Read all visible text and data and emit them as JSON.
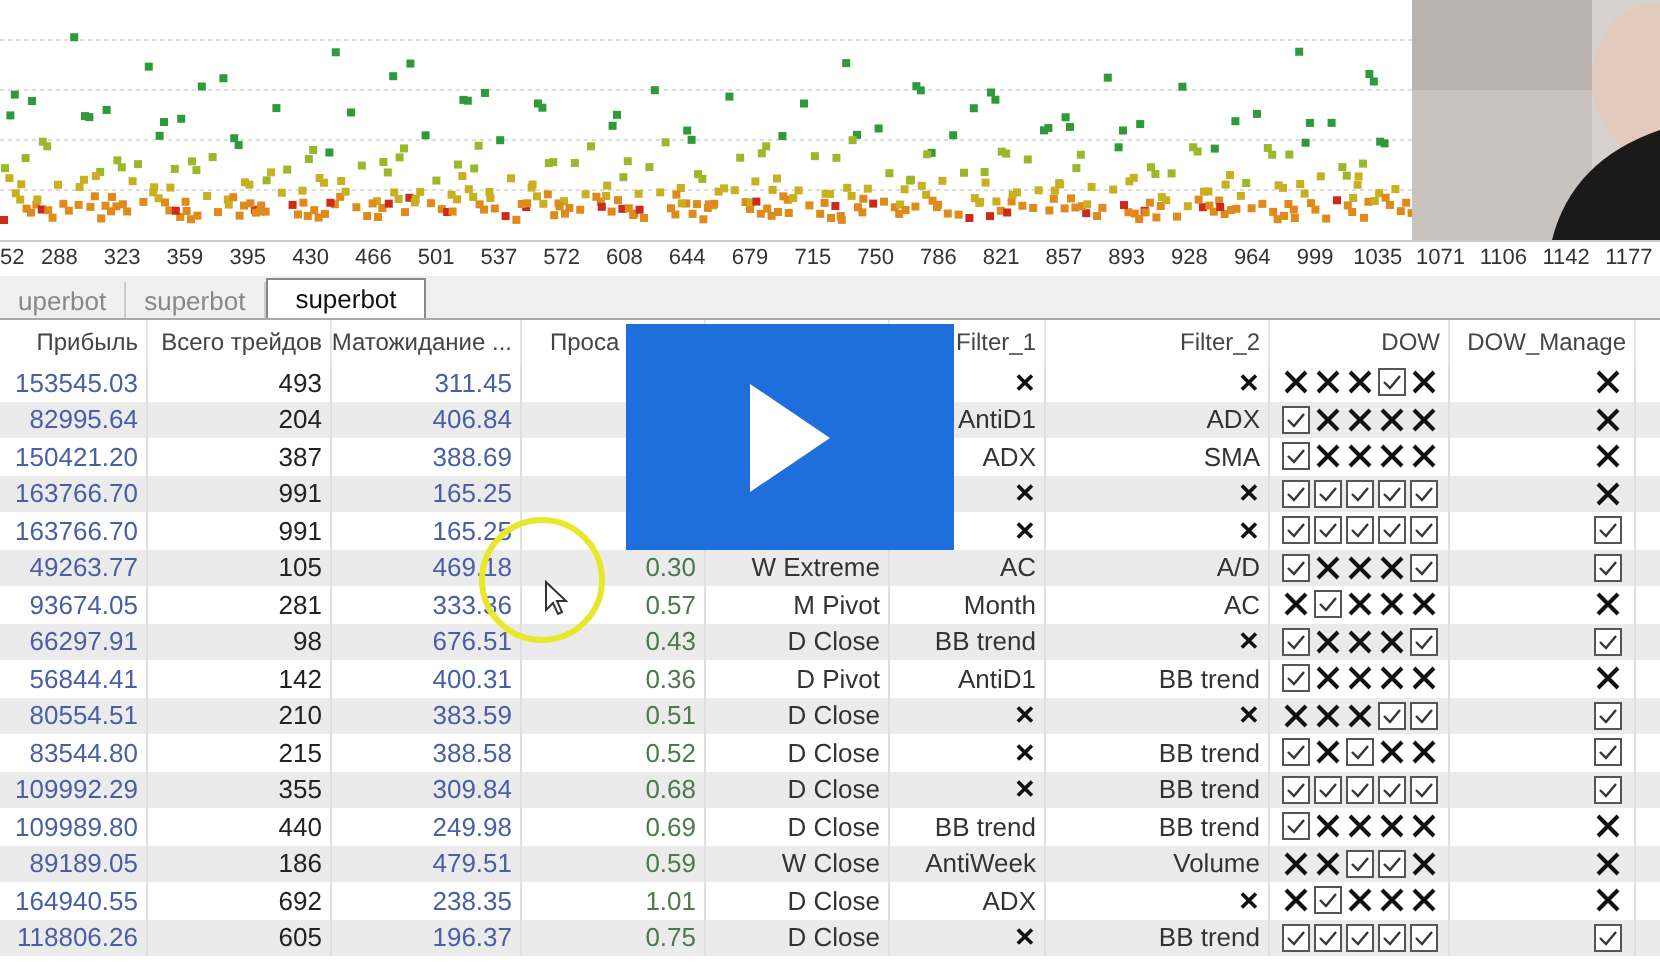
{
  "chart": {
    "x_tick_labels": [
      "52",
      "288",
      "323",
      "359",
      "395",
      "430",
      "466",
      "501",
      "537",
      "572",
      "608",
      "644",
      "679",
      "715",
      "750",
      "786",
      "821",
      "857",
      "893",
      "928",
      "964",
      "999",
      "1035",
      "1071",
      "1106",
      "1142",
      "1177"
    ]
  },
  "tabs": [
    {
      "label": "uperbot",
      "selected": false
    },
    {
      "label": "superbot",
      "selected": false
    },
    {
      "label": "superbot",
      "selected": true
    }
  ],
  "table": {
    "columns": [
      "Прибыль",
      "Всего трейдов",
      "Матожидание ...",
      "Проса",
      null,
      "Filter_1",
      "Filter_2",
      "DOW",
      "DOW_Manage"
    ],
    "rows": [
      {
        "profit": "153545.03",
        "trades": "493",
        "expectation": "311.45",
        "drawdown": null,
        "signal": null,
        "filter_1": "✕",
        "filter_2": "✕",
        "dow": [
          false,
          false,
          false,
          true,
          false
        ],
        "dow_manage": false
      },
      {
        "profit": "82995.64",
        "trades": "204",
        "expectation": "406.84",
        "drawdown": null,
        "signal": null,
        "filter_1": "AntiD1",
        "filter_2": "ADX",
        "dow": [
          true,
          false,
          false,
          false,
          false
        ],
        "dow_manage": false
      },
      {
        "profit": "150421.20",
        "trades": "387",
        "expectation": "388.69",
        "drawdown": null,
        "signal": null,
        "filter_1": "ADX",
        "filter_2": "SMA",
        "dow": [
          true,
          false,
          false,
          false,
          false
        ],
        "dow_manage": false
      },
      {
        "profit": "163766.70",
        "trades": "991",
        "expectation": "165.25",
        "drawdown": null,
        "signal": null,
        "filter_1": "✕",
        "filter_2": "✕",
        "dow": [
          true,
          true,
          true,
          true,
          true
        ],
        "dow_manage": false
      },
      {
        "profit": "163766.70",
        "trades": "991",
        "expectation": "165.25",
        "drawdown": null,
        "signal": null,
        "filter_1": "✕",
        "filter_2": "✕",
        "dow": [
          true,
          true,
          true,
          true,
          true
        ],
        "dow_manage": true
      },
      {
        "profit": "49263.77",
        "trades": "105",
        "expectation": "469.18",
        "drawdown": "0.30",
        "signal": "W Extreme",
        "filter_1": "AC",
        "filter_2": "A/D",
        "dow": [
          true,
          false,
          false,
          false,
          true
        ],
        "dow_manage": true
      },
      {
        "profit": "93674.05",
        "trades": "281",
        "expectation": "333.36",
        "drawdown": "0.57",
        "signal": "M Pivot",
        "filter_1": "Month",
        "filter_2": "AC",
        "dow": [
          false,
          true,
          false,
          false,
          false
        ],
        "dow_manage": false
      },
      {
        "profit": "66297.91",
        "trades": "98",
        "expectation": "676.51",
        "drawdown": "0.43",
        "signal": "D Close",
        "filter_1": "BB trend",
        "filter_2": "✕",
        "dow": [
          true,
          false,
          false,
          false,
          true
        ],
        "dow_manage": true
      },
      {
        "profit": "56844.41",
        "trades": "142",
        "expectation": "400.31",
        "drawdown": "0.36",
        "signal": "D Pivot",
        "filter_1": "AntiD1",
        "filter_2": "BB trend",
        "dow": [
          true,
          false,
          false,
          false,
          false
        ],
        "dow_manage": false
      },
      {
        "profit": "80554.51",
        "trades": "210",
        "expectation": "383.59",
        "drawdown": "0.51",
        "signal": "D Close",
        "filter_1": "✕",
        "filter_2": "✕",
        "dow": [
          false,
          false,
          false,
          true,
          true
        ],
        "dow_manage": true
      },
      {
        "profit": "83544.80",
        "trades": "215",
        "expectation": "388.58",
        "drawdown": "0.52",
        "signal": "D Close",
        "filter_1": "✕",
        "filter_2": "BB trend",
        "dow": [
          true,
          false,
          true,
          false,
          false
        ],
        "dow_manage": true
      },
      {
        "profit": "109992.29",
        "trades": "355",
        "expectation": "309.84",
        "drawdown": "0.68",
        "signal": "D Close",
        "filter_1": "✕",
        "filter_2": "BB trend",
        "dow": [
          true,
          true,
          true,
          true,
          true
        ],
        "dow_manage": true
      },
      {
        "profit": "109989.80",
        "trades": "440",
        "expectation": "249.98",
        "drawdown": "0.69",
        "signal": "D Close",
        "filter_1": "BB trend",
        "filter_2": "BB trend",
        "dow": [
          true,
          false,
          false,
          false,
          false
        ],
        "dow_manage": false
      },
      {
        "profit": "89189.05",
        "trades": "186",
        "expectation": "479.51",
        "drawdown": "0.59",
        "signal": "W Close",
        "filter_1": "AntiWeek",
        "filter_2": "Volume",
        "dow": [
          false,
          false,
          true,
          true,
          false
        ],
        "dow_manage": false
      },
      {
        "profit": "164940.55",
        "trades": "692",
        "expectation": "238.35",
        "drawdown": "1.01",
        "signal": "D Close",
        "filter_1": "ADX",
        "filter_2": "✕",
        "dow": [
          false,
          true,
          false,
          false,
          false
        ],
        "dow_manage": false
      },
      {
        "profit": "118806.26",
        "trades": "605",
        "expectation": "196.37",
        "drawdown": "0.75",
        "signal": "D Close",
        "filter_1": "✕",
        "filter_2": "BB trend",
        "dow": [
          true,
          true,
          true,
          true,
          true
        ],
        "dow_manage": true
      }
    ]
  }
}
